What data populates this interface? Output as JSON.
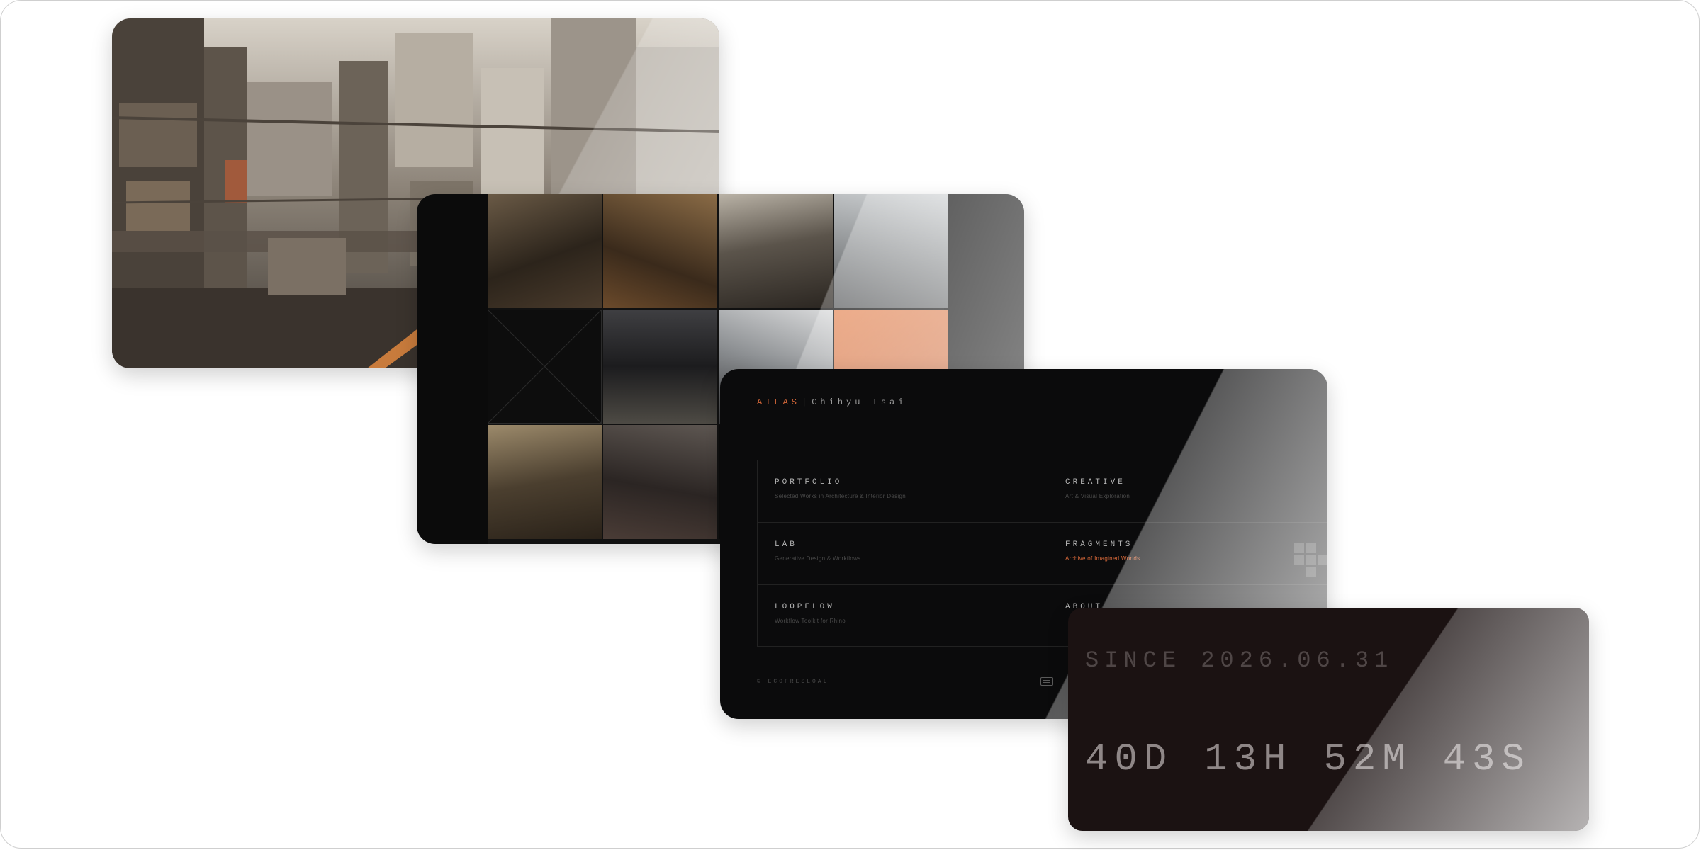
{
  "atlas": {
    "brand": "ATLAS",
    "separator": "|",
    "author": "Chihyu Tsai",
    "menu": [
      {
        "title": "PORTFOLIO",
        "subtitle": "Selected Works in Architecture & Interior Design",
        "active": false
      },
      {
        "title": "CREATIVE",
        "subtitle": "Art & Visual Exploration",
        "active": false
      },
      {
        "title": "LAB",
        "subtitle": "Generative Design & Workflows",
        "active": false
      },
      {
        "title": "FRAGMENTS",
        "subtitle": "Archive of Imagined Worlds",
        "active": true
      },
      {
        "title": "LOOPFLOW",
        "subtitle": "Workflow Toolkit for Rhino",
        "active": false
      },
      {
        "title": "ABOUT",
        "subtitle": "",
        "active": false
      }
    ],
    "footer": "© ECOFRESLOAL"
  },
  "countdown": {
    "since": "SINCE 2026.06.31",
    "days": "40D",
    "hours": "13H",
    "minutes": "52M",
    "seconds": "43S"
  },
  "colors": {
    "accent": "#d9693a",
    "countdown_bg": "#1b1212",
    "atlas_bg": "#0b0b0c"
  },
  "icons": {
    "footer_icon": "keyboard-icon"
  }
}
